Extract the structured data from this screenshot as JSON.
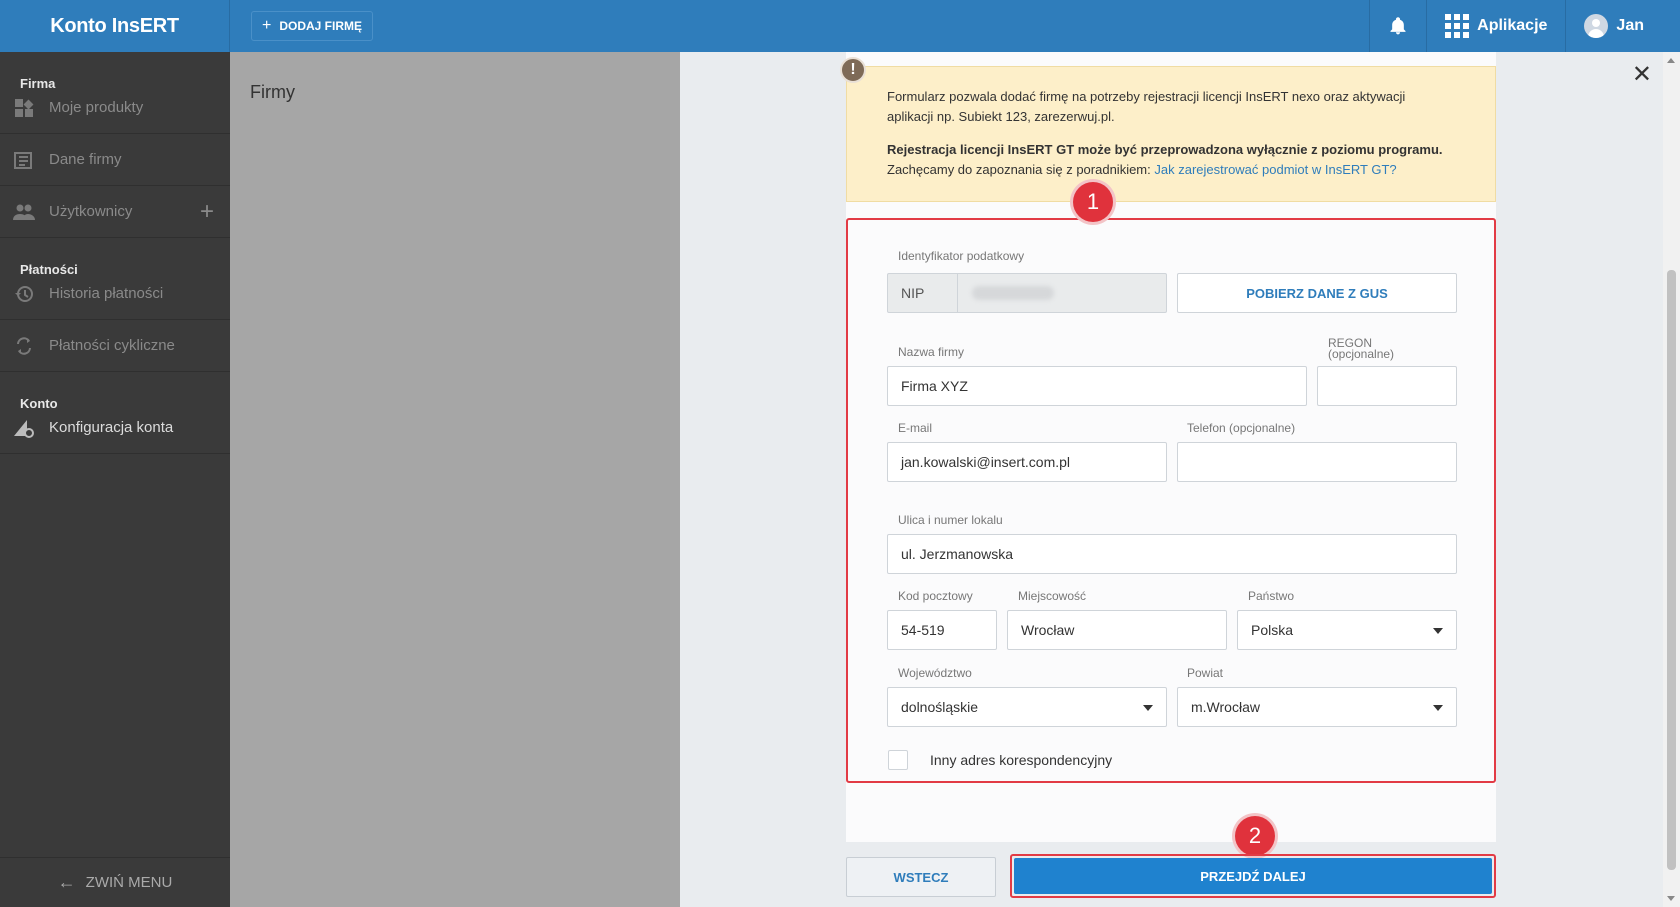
{
  "header": {
    "brand": "Konto InsERT",
    "add_firm_label": "DODAJ FIRMĘ",
    "apps_label": "Aplikacje",
    "user_name": "Jan"
  },
  "sidebar": {
    "sections": [
      {
        "title": "Firma",
        "items": [
          {
            "label": "Moje produkty",
            "icon": "products-icon"
          },
          {
            "label": "Dane firmy",
            "icon": "company-data-icon"
          },
          {
            "label": "Użytkownicy",
            "icon": "users-icon"
          }
        ]
      },
      {
        "title": "Płatności",
        "items": [
          {
            "label": "Historia płatności",
            "icon": "history-icon"
          },
          {
            "label": "Płatności cykliczne",
            "icon": "recurring-payments-icon"
          }
        ]
      },
      {
        "title": "Konto",
        "items": [
          {
            "label": "Konfiguracja konta",
            "icon": "account-settings-icon"
          }
        ]
      }
    ],
    "collapse_label": "ZWIŃ MENU"
  },
  "main": {
    "title": "Firmy"
  },
  "notice": {
    "text1": "Formularz pozwala dodać firmę na potrzeby rejestracji licencji InsERT nexo oraz aktywacji aplikacji np. Subiekt 123, zarezerwuj.pl.",
    "text2_bold": "Rejestracja licencji InsERT GT może być przeprowadzona wyłącznie z poziomu programu.",
    "text3": "Zachęcamy do zapoznania się z poradnikiem: ",
    "link": "Jak zarejestrować podmiot w InsERT GT?"
  },
  "form": {
    "tax_id_label": "Identyfikator podatkowy",
    "nip_prefix": "NIP",
    "gus_button": "POBIERZ DANE Z GUS",
    "company_name_label": "Nazwa firmy",
    "company_name_value": "Firma XYZ",
    "regon_label_1": "REGON",
    "regon_label_2": "(opcjonalne)",
    "regon_value": "",
    "email_label": "E-mail",
    "email_value": "jan.kowalski@insert.com.pl",
    "phone_label": "Telefon (opcjonalne)",
    "phone_value": "",
    "street_label": "Ulica i numer lokalu",
    "street_value": "ul. Jerzmanowska",
    "postal_label": "Kod pocztowy",
    "postal_value": "54-519",
    "city_label": "Miejscowość",
    "city_value": "Wrocław",
    "country_label": "Państwo",
    "country_value": "Polska",
    "voivodeship_label": "Województwo",
    "voivodeship_value": "dolnośląskie",
    "county_label": "Powiat",
    "county_value": "m.Wrocław",
    "alt_address_label": "Inny adres korespondencyjny"
  },
  "steps": {
    "step1": "1",
    "step2": "2"
  },
  "buttons": {
    "back": "WSTECZ",
    "next": "PRZEJDŹ DALEJ"
  },
  "colors": {
    "brand": "#2f7dbb",
    "highlight": "#e23b45",
    "notice_bg": "#fdefc9",
    "primary_button": "#1f82cf"
  }
}
